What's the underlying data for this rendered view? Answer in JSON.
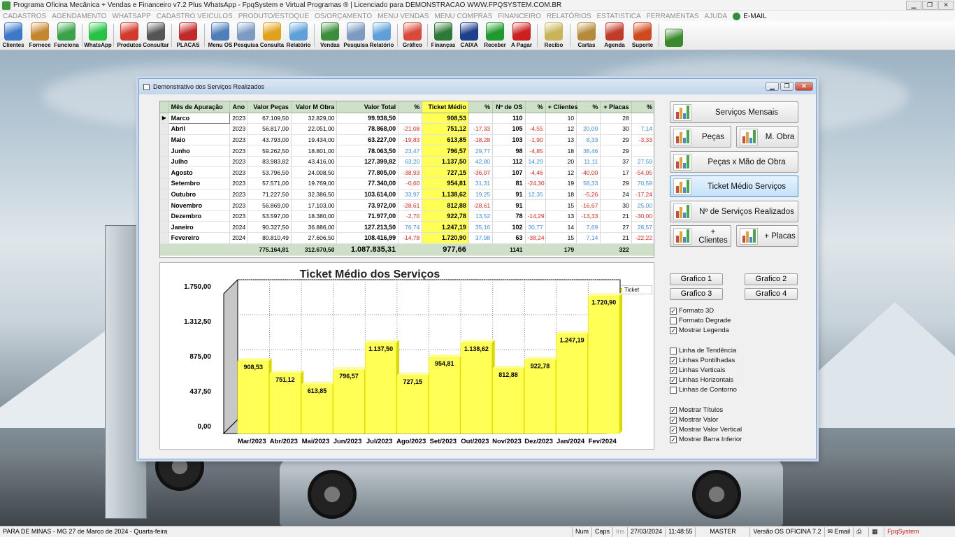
{
  "window": {
    "title": "Programa Oficina Mecânica + Vendas e Financeiro v7.2 Plus WhatsApp - FpqSystem e Virtual Programas ® | Licenciado para  DEMONSTRACAO WWW.FPQSYSTEM.COM.BR"
  },
  "menu": {
    "items": [
      "CADASTROS",
      "AGENDAMENTO",
      "WHATSAPP",
      "CADASTRO VEICULOS",
      "PRODUTO/ESTOQUE",
      "OS/ORÇAMENTO",
      "MENU VENDAS",
      "MENU COMPRAS",
      "FINANCEIRO",
      "RELATÓRIOS",
      "ESTATISTICA",
      "FERRAMENTAS",
      "AJUDA"
    ],
    "email": "E-MAIL"
  },
  "toolbar": [
    {
      "label": "Clientes",
      "icon": "clients-icon",
      "color": "#3d79c9"
    },
    {
      "label": "Fornece",
      "icon": "supplier-icon",
      "color": "#c4872f"
    },
    {
      "label": "Funciona",
      "icon": "employee-icon",
      "color": "#3aa24a"
    },
    {
      "sep": true
    },
    {
      "label": "WhatsApp",
      "icon": "whatsapp-icon",
      "color": "#25c244"
    },
    {
      "sep": true
    },
    {
      "label": "Produtos",
      "icon": "products-icon",
      "color": "#d23b2b"
    },
    {
      "label": "Consultar",
      "icon": "barcode-icon",
      "color": "#555555"
    },
    {
      "sep": true
    },
    {
      "label": "PLACAS",
      "icon": "truck-icon",
      "color": "#c02a2a"
    },
    {
      "sep": true
    },
    {
      "label": "Menu OS",
      "icon": "os-icon",
      "color": "#4f7fb8"
    },
    {
      "label": "Pesquisa",
      "icon": "search-doc-icon",
      "color": "#7d9bc0"
    },
    {
      "label": "Consulta",
      "icon": "folder-icon",
      "color": "#e0a21c"
    },
    {
      "label": "Relatório",
      "icon": "report-icon",
      "color": "#5fa0d8"
    },
    {
      "sep": true
    },
    {
      "label": "Vendas",
      "icon": "cart-icon",
      "color": "#3b8e3b"
    },
    {
      "label": "Pesquisa",
      "icon": "search-doc-icon",
      "color": "#7d9bc0"
    },
    {
      "label": "Relatório",
      "icon": "report-icon",
      "color": "#5fa0d8"
    },
    {
      "sep": true
    },
    {
      "label": "Gráfico",
      "icon": "chart-icon",
      "color": "#d94a3b"
    },
    {
      "sep": true
    },
    {
      "label": "Finanças",
      "icon": "finance-icon",
      "color": "#2f7a38"
    },
    {
      "label": "CAIXA",
      "icon": "cash-icon",
      "color": "#1e3f8a"
    },
    {
      "label": "Receber",
      "icon": "receive-icon",
      "color": "#1f9a2e"
    },
    {
      "label": "A Pagar",
      "icon": "pay-icon",
      "color": "#cc1f1f"
    },
    {
      "sep": true
    },
    {
      "label": "Recibo",
      "icon": "receipt-icon",
      "color": "#c9b45a"
    },
    {
      "sep": true
    },
    {
      "label": "Cartas",
      "icon": "letters-icon",
      "color": "#b58a3a"
    },
    {
      "label": "Agenda",
      "icon": "calendar-icon",
      "color": "#c23a2a"
    },
    {
      "label": "Suporte",
      "icon": "support-icon",
      "color": "#d04a1f"
    },
    {
      "sep": true
    },
    {
      "label": "",
      "icon": "exit-icon",
      "color": "#3a8a2c"
    }
  ],
  "dialog": {
    "title": "Demonstrativo dos Serviços Realizados"
  },
  "grid": {
    "headers": [
      "Mês de Apuração",
      "Ano",
      "Valor Peças",
      "Valor M Obra",
      "Valor Total",
      "%",
      "Ticket Médio",
      "%",
      "Nº de OS",
      "%",
      "+ Clientes",
      "%",
      "+ Placas",
      "%"
    ],
    "rows": [
      {
        "mes": "Marco",
        "ano": "2023",
        "pecas": "67.109,50",
        "mobra": "32.829,00",
        "total": "99.938,50",
        "p1": "",
        "ticket": "908,53",
        "p2": "",
        "os": "110",
        "p3": "",
        "cli": "10",
        "p4": "",
        "placas": "28",
        "p5": ""
      },
      {
        "mes": "Abril",
        "ano": "2023",
        "pecas": "56.817,00",
        "mobra": "22.051,00",
        "total": "78.868,00",
        "p1": "-21,08",
        "ticket": "751,12",
        "p2": "-17,33",
        "os": "105",
        "p3": "-4,55",
        "cli": "12",
        "p4": "20,00",
        "placas": "30",
        "p5": "7,14"
      },
      {
        "mes": "Maio",
        "ano": "2023",
        "pecas": "43.793,00",
        "mobra": "19.434,00",
        "total": "63.227,00",
        "p1": "-19,83",
        "ticket": "613,85",
        "p2": "-18,28",
        "os": "103",
        "p3": "-1,90",
        "cli": "13",
        "p4": "8,33",
        "placas": "29",
        "p5": "-3,33"
      },
      {
        "mes": "Junho",
        "ano": "2023",
        "pecas": "59.262,50",
        "mobra": "18.801,00",
        "total": "78.063,50",
        "p1": "23,47",
        "ticket": "796,57",
        "p2": "29,77",
        "os": "98",
        "p3": "-4,85",
        "cli": "18",
        "p4": "38,46",
        "placas": "29",
        "p5": ""
      },
      {
        "mes": "Julho",
        "ano": "2023",
        "pecas": "83.983,82",
        "mobra": "43.416,00",
        "total": "127.399,82",
        "p1": "63,20",
        "ticket": "1.137,50",
        "p2": "42,80",
        "os": "112",
        "p3": "14,29",
        "cli": "20",
        "p4": "11,11",
        "placas": "37",
        "p5": "27,59"
      },
      {
        "mes": "Agosto",
        "ano": "2023",
        "pecas": "53.796,50",
        "mobra": "24.008,50",
        "total": "77.805,00",
        "p1": "-38,93",
        "ticket": "727,15",
        "p2": "-36,07",
        "os": "107",
        "p3": "-4,46",
        "cli": "12",
        "p4": "-40,00",
        "placas": "17",
        "p5": "-54,05"
      },
      {
        "mes": "Setembro",
        "ano": "2023",
        "pecas": "57.571,00",
        "mobra": "19.769,00",
        "total": "77.340,00",
        "p1": "-0,60",
        "ticket": "954,81",
        "p2": "31,31",
        "os": "81",
        "p3": "-24,30",
        "cli": "19",
        "p4": "58,33",
        "placas": "29",
        "p5": "70,59"
      },
      {
        "mes": "Outubro",
        "ano": "2023",
        "pecas": "71.227,50",
        "mobra": "32.386,50",
        "total": "103.614,00",
        "p1": "33,97",
        "ticket": "1.138,62",
        "p2": "19,25",
        "os": "91",
        "p3": "12,35",
        "cli": "18",
        "p4": "-5,26",
        "placas": "24",
        "p5": "-17,24"
      },
      {
        "mes": "Novembro",
        "ano": "2023",
        "pecas": "56.869,00",
        "mobra": "17.103,00",
        "total": "73.972,00",
        "p1": "-28,61",
        "ticket": "812,88",
        "p2": "-28,61",
        "os": "91",
        "p3": "",
        "cli": "15",
        "p4": "-16,67",
        "placas": "30",
        "p5": "25,00"
      },
      {
        "mes": "Dezembro",
        "ano": "2023",
        "pecas": "53.597,00",
        "mobra": "18.380,00",
        "total": "71.977,00",
        "p1": "-2,70",
        "ticket": "922,78",
        "p2": "13,52",
        "os": "78",
        "p3": "-14,29",
        "cli": "13",
        "p4": "-13,33",
        "placas": "21",
        "p5": "-30,00"
      },
      {
        "mes": "Janeiro",
        "ano": "2024",
        "pecas": "90.327,50",
        "mobra": "36.886,00",
        "total": "127.213,50",
        "p1": "76,74",
        "ticket": "1.247,19",
        "p2": "35,16",
        "os": "102",
        "p3": "30,77",
        "cli": "14",
        "p4": "7,69",
        "placas": "27",
        "p5": "28,57"
      },
      {
        "mes": "Fevereiro",
        "ano": "2024",
        "pecas": "80.810,49",
        "mobra": "27.606,50",
        "total": "108.416,99",
        "p1": "-14,78",
        "ticket": "1.720,90",
        "p2": "37,98",
        "os": "63",
        "p3": "-38,24",
        "cli": "15",
        "p4": "7,14",
        "placas": "21",
        "p5": "-22,22"
      }
    ],
    "totals": {
      "pecas": "775.164,81",
      "mobra": "312.670,50",
      "total": "1.087.835,31",
      "ticket": "977,66",
      "os": "1141",
      "cli": "179",
      "placas": "322"
    }
  },
  "chart_data": {
    "type": "bar",
    "title": "Ticket Médio dos Serviços",
    "categories": [
      "Mar/2023",
      "Abr/2023",
      "Mai/2023",
      "Jun/2023",
      "Jul/2023",
      "Ago/2023",
      "Set/2023",
      "Out/2023",
      "Nov/2023",
      "Dez/2023",
      "Jan/2024",
      "Fev/2024"
    ],
    "series": [
      {
        "name": "Ticket",
        "values": [
          908.53,
          751.12,
          613.85,
          796.57,
          1137.5,
          727.15,
          954.81,
          1138.62,
          812.88,
          922.78,
          1247.19,
          1720.9
        ]
      }
    ],
    "value_labels": [
      "908,53",
      "751,12",
      "613,85",
      "796,57",
      "1.137,50",
      "727,15",
      "954,81",
      "1.138,62",
      "812,88",
      "922,78",
      "1.247,19",
      "1.720,90"
    ],
    "yticks": [
      "0,00",
      "437,50",
      "875,00",
      "1.312,50",
      "1.750,00"
    ],
    "ylim": [
      0,
      1750
    ],
    "bar_color": "#ffff55",
    "style": "3d",
    "grid": "dotted",
    "legend": "top-right"
  },
  "right_panel": {
    "buttons": [
      "Serviços Mensais",
      "Peças",
      "M. Obra",
      "Peças x Mão de Obra",
      "Ticket Médio Serviços",
      "Nº de Serviços Realizados",
      "+ Clientes",
      "+ Placas"
    ],
    "graph_buttons": [
      "Grafico 1",
      "Grafico 2",
      "Grafico 3",
      "Grafico 4"
    ],
    "checkboxes": [
      {
        "label": "Formato 3D",
        "checked": true
      },
      {
        "label": "Formato Degrade",
        "checked": false
      },
      {
        "label": "Mostrar Legenda",
        "checked": true
      },
      {
        "label": "Linha de Tendência",
        "checked": false
      },
      {
        "label": "Linhas Pontilhadas",
        "checked": true
      },
      {
        "label": "Linhas Verticais",
        "checked": true
      },
      {
        "label": "Linhas Horizontais",
        "checked": true
      },
      {
        "label": "Linhas de Contorno",
        "checked": false
      },
      {
        "label": "Mostrar Títulos",
        "checked": true
      },
      {
        "label": "Mostrar Valor",
        "checked": true
      },
      {
        "label": "Mostrar Valor Vertical",
        "checked": true
      },
      {
        "label": "Mostrar Barra Inferior",
        "checked": true
      }
    ]
  },
  "status": {
    "location": "PARA DE MINAS - MG 27 de Marco de 2024 - Quarta-feira",
    "num": "Num",
    "caps": "Caps",
    "ins": "Ins",
    "date": "27/03/2024",
    "time": "11:48:55",
    "user": "MASTER",
    "version": "Versão OS OFICINA 7.2",
    "email": "Email",
    "brand": "FpqSystem"
  }
}
